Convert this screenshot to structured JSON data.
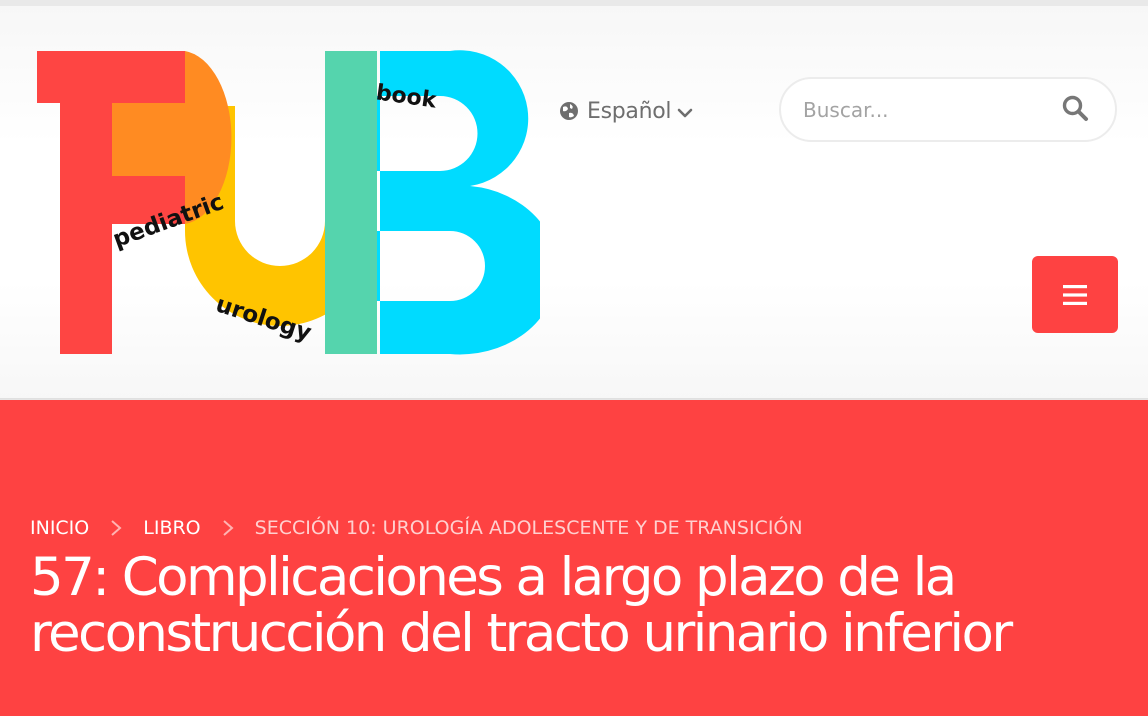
{
  "logo": {
    "letters": "PUB",
    "words": {
      "top": "book",
      "middle": "pediatric",
      "bottom": "urology"
    },
    "colors": {
      "red": "#fe4543",
      "orange": "#ff8b22",
      "yellow": "#ffc400",
      "teal": "#55d4ad",
      "cyan": "#00dbff"
    }
  },
  "header": {
    "language": {
      "label": "Español",
      "icon": "globe-icon",
      "chevron": "chevron-down-icon"
    },
    "search": {
      "placeholder": "Buscar...",
      "value": "",
      "icon": "search-icon"
    },
    "menu": {
      "icon": "hamburger-icon"
    }
  },
  "hero": {
    "background": "#fe4242",
    "breadcrumb": [
      "INICIO",
      "LIBRO",
      "SECCIÓN 10: UROLOGÍA ADOLESCENTE Y DE TRANSICIÓN"
    ],
    "separator_icon": "chevron-right-icon",
    "title_line1": "57: Complicaciones a largo plazo de la",
    "title_line2": "reconstrucción del tracto urinario inferior"
  }
}
